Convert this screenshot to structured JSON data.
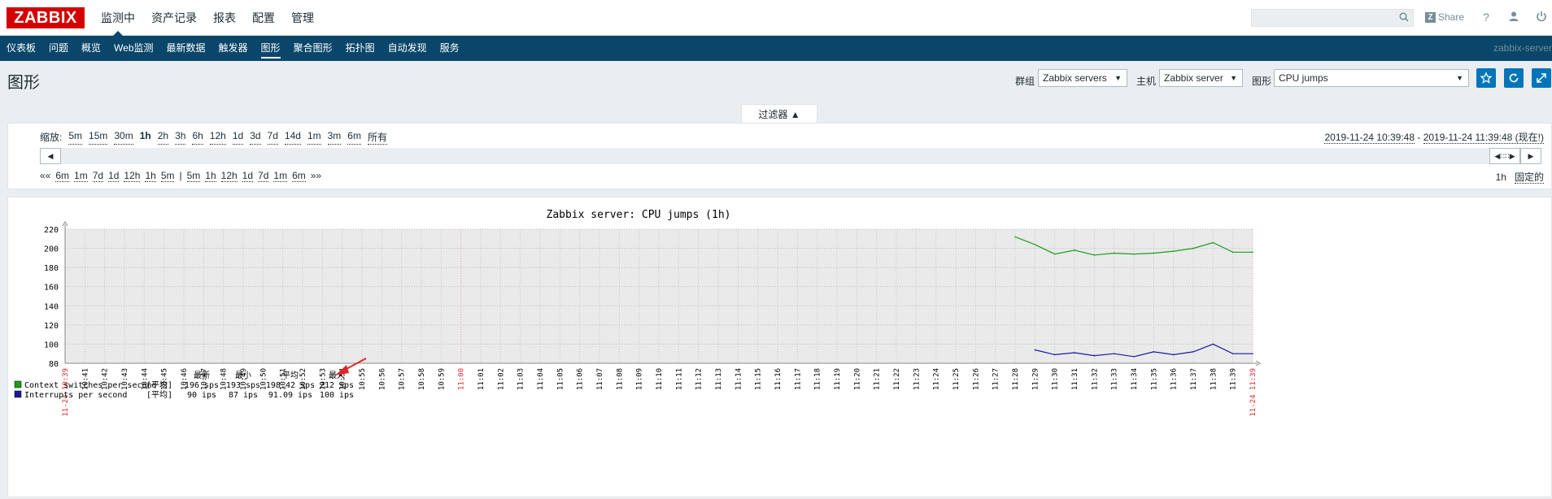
{
  "brand": {
    "logo": "ZABBIX",
    "logo_color": "#d40000"
  },
  "top_menu": [
    {
      "label": "监测中",
      "active": true
    },
    {
      "label": "资产记录",
      "active": false
    },
    {
      "label": "报表",
      "active": false
    },
    {
      "label": "配置",
      "active": false
    },
    {
      "label": "管理",
      "active": false
    }
  ],
  "top_right": {
    "search_placeholder": "",
    "share_label": "Share",
    "help_icon": "question-icon",
    "user_icon": "user-icon",
    "power_icon": "power-icon"
  },
  "sub_menu": [
    {
      "label": "仪表板",
      "active": false
    },
    {
      "label": "问题",
      "active": false
    },
    {
      "label": "概览",
      "active": false
    },
    {
      "label": "Web监测",
      "active": false
    },
    {
      "label": "最新数据",
      "active": false
    },
    {
      "label": "触发器",
      "active": false
    },
    {
      "label": "图形",
      "active": true
    },
    {
      "label": "聚合图形",
      "active": false
    },
    {
      "label": "拓扑图",
      "active": false
    },
    {
      "label": "自动发现",
      "active": false
    },
    {
      "label": "服务",
      "active": false
    }
  ],
  "server_name": "zabbix-server",
  "page": {
    "title": "图形",
    "group_label": "群组",
    "group_value": "Zabbix servers",
    "host_label": "主机",
    "host_value": "Zabbix server",
    "graph_label": "图形",
    "graph_value": "CPU jumps"
  },
  "filter": {
    "tab_label": "过滤器 ▲",
    "zoom_label": "缩放:",
    "zoom_options": [
      {
        "label": "5m",
        "active": false
      },
      {
        "label": "15m",
        "active": false
      },
      {
        "label": "30m",
        "active": false
      },
      {
        "label": "1h",
        "active": true
      },
      {
        "label": "2h",
        "active": false
      },
      {
        "label": "3h",
        "active": false
      },
      {
        "label": "6h",
        "active": false
      },
      {
        "label": "12h",
        "active": false
      },
      {
        "label": "1d",
        "active": false
      },
      {
        "label": "3d",
        "active": false
      },
      {
        "label": "7d",
        "active": false
      },
      {
        "label": "14d",
        "active": false
      },
      {
        "label": "1m",
        "active": false
      },
      {
        "label": "3m",
        "active": false
      },
      {
        "label": "6m",
        "active": false
      },
      {
        "label": "所有",
        "active": false
      }
    ],
    "period_from": "2019-11-24 10:39:48",
    "period_sep": " - ",
    "period_to": "2019-11-24 11:39:48 (现在!)",
    "nav_back": [
      "««",
      "6m",
      "1m",
      "7d",
      "1d",
      "12h",
      "1h",
      "5m"
    ],
    "nav_sep": "|",
    "nav_fwd": [
      "5m",
      "1h",
      "12h",
      "1d",
      "7d",
      "1m",
      "6m",
      "»»"
    ],
    "period_label": "1h",
    "fixed_label": "固定的"
  },
  "chart_data": {
    "type": "line",
    "title": "Zabbix server: CPU jumps (1h)",
    "ylim": [
      80,
      220
    ],
    "y_ticks": [
      80,
      100,
      120,
      140,
      160,
      180,
      200,
      220
    ],
    "x_labels": [
      "11-24 10:39",
      "10:41",
      "10:42",
      "10:43",
      "10:44",
      "10:45",
      "10:46",
      "10:47",
      "10:48",
      "10:49",
      "10:50",
      "10:51",
      "10:52",
      "10:53",
      "10:54",
      "10:55",
      "10:56",
      "10:57",
      "10:58",
      "10:59",
      "11:00",
      "11:01",
      "11:02",
      "11:03",
      "11:04",
      "11:05",
      "11:06",
      "11:07",
      "11:08",
      "11:09",
      "11:10",
      "11:11",
      "11:12",
      "11:13",
      "11:14",
      "11:15",
      "11:16",
      "11:17",
      "11:18",
      "11:19",
      "11:20",
      "11:21",
      "11:22",
      "11:23",
      "11:24",
      "11:25",
      "11:26",
      "11:27",
      "11:28",
      "11:29",
      "11:30",
      "11:31",
      "11:32",
      "11:33",
      "11:34",
      "11:35",
      "11:36",
      "11:37",
      "11:38",
      "11:39",
      "11-24 11:39"
    ],
    "grid": true,
    "series": [
      {
        "name": "Context switches per second",
        "color": "#1a9f1a",
        "x": [
          "11:28",
          "11:29",
          "11:30",
          "11:31",
          "11:32",
          "11:33",
          "11:34",
          "11:35",
          "11:36",
          "11:37",
          "11:38",
          "11:39",
          "11:39:48"
        ],
        "values": [
          212,
          204,
          194,
          198,
          193,
          195,
          194,
          195,
          197,
          200,
          206,
          196,
          196
        ]
      },
      {
        "name": "Interrupts per second",
        "color": "#1a1a9f",
        "x": [
          "11:29",
          "11:30",
          "11:31",
          "11:32",
          "11:33",
          "11:34",
          "11:35",
          "11:36",
          "11:37",
          "11:38",
          "11:39",
          "11:39:48"
        ],
        "values": [
          94,
          89,
          91,
          88,
          90,
          87,
          92,
          89,
          92,
          100,
          90,
          90
        ]
      }
    ],
    "legend": {
      "headers": [
        "最新",
        "最小",
        "平均",
        "最大"
      ],
      "rows": [
        {
          "name": "Context switches per second",
          "func": "[平均]",
          "last": "196 sps",
          "min": "193 sps",
          "avg": "198.42 sps",
          "max": "212 sps",
          "color": "#1a9f1a"
        },
        {
          "name": "Interrupts per second",
          "func": "[平均]",
          "last": "90 ips",
          "min": "87 ips",
          "avg": "91.09 ips",
          "max": "100 ips",
          "color": "#1a1a9f"
        }
      ]
    },
    "annotation": {
      "type": "red-arrow",
      "color": "#e0262b"
    }
  }
}
